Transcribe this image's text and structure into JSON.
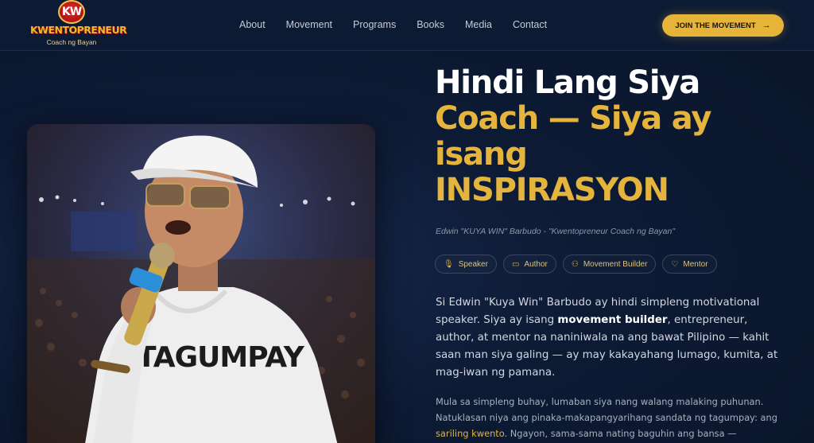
{
  "brand": {
    "badge": "KW",
    "name": "KWENTOPRENEUR",
    "tagline": "Coach ng Bayan",
    "accent": "#e4b43d"
  },
  "nav": {
    "links": [
      "About",
      "Movement",
      "Programs",
      "Books",
      "Media",
      "Contact"
    ],
    "cta_label": "JOIN THE MOVEMENT",
    "cta_icon": "arrow-right-icon"
  },
  "hero": {
    "photo_shirt_text": "TAGUMPAY",
    "headline_line1": "Hindi Lang Siya",
    "headline_line2": "Coach — Siya ay",
    "headline_line3": "isang",
    "headline_line4": "INSPIRASYON",
    "subline": "Edwin \"KUYA WIN\" Barbudo - \"Kwentopreneur Coach ng Bayan\"",
    "tags": [
      {
        "label": "Speaker",
        "icon": "microphone-icon"
      },
      {
        "label": "Author",
        "icon": "book-icon"
      },
      {
        "label": "Movement Builder",
        "icon": "users-icon"
      },
      {
        "label": "Mentor",
        "icon": "heart-icon"
      }
    ],
    "para1_a": "Si Edwin \"Kuya Win\" Barbudo ay hindi simpleng motivational speaker. Siya ay isang ",
    "para1_bold": "movement builder",
    "para1_b": ", entrepreneur, author, at mentor na naniniwala na ang bawat Pilipino — kahit saan man siya galing — ay may kakayahang lumago, kumita, at mag-iwan ng pamana.",
    "para2_a": "Mula sa simpleng buhay, lumaban siya nang walang malaking puhunan. Natuklasan niya ang pinaka-makapangyarihang sandata ng tagumpay: ang ",
    "para2_gold": "sariling kwento",
    "para2_b": ". Ngayon, sama-sama nating baguhin ang bansa —"
  }
}
